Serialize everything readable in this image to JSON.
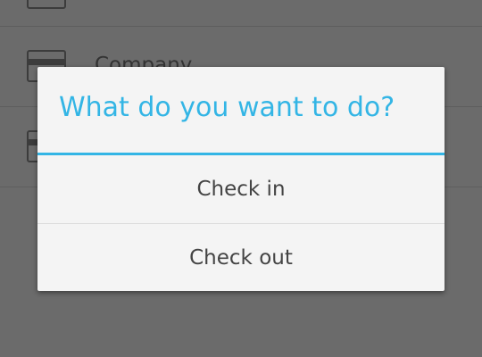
{
  "list": {
    "items": [
      {
        "label": "",
        "icon": "card-icon"
      },
      {
        "label": "Company",
        "icon": "card-icon"
      },
      {
        "label": "",
        "icon": "card-icon"
      }
    ]
  },
  "dialog": {
    "title": "What do you want to do?",
    "options": [
      {
        "label": "Check in"
      },
      {
        "label": "Check out"
      }
    ]
  },
  "colors": {
    "accent": "#33b5e5",
    "dialog_bg": "#f4f4f4",
    "scrim": "#6b6b6b"
  }
}
